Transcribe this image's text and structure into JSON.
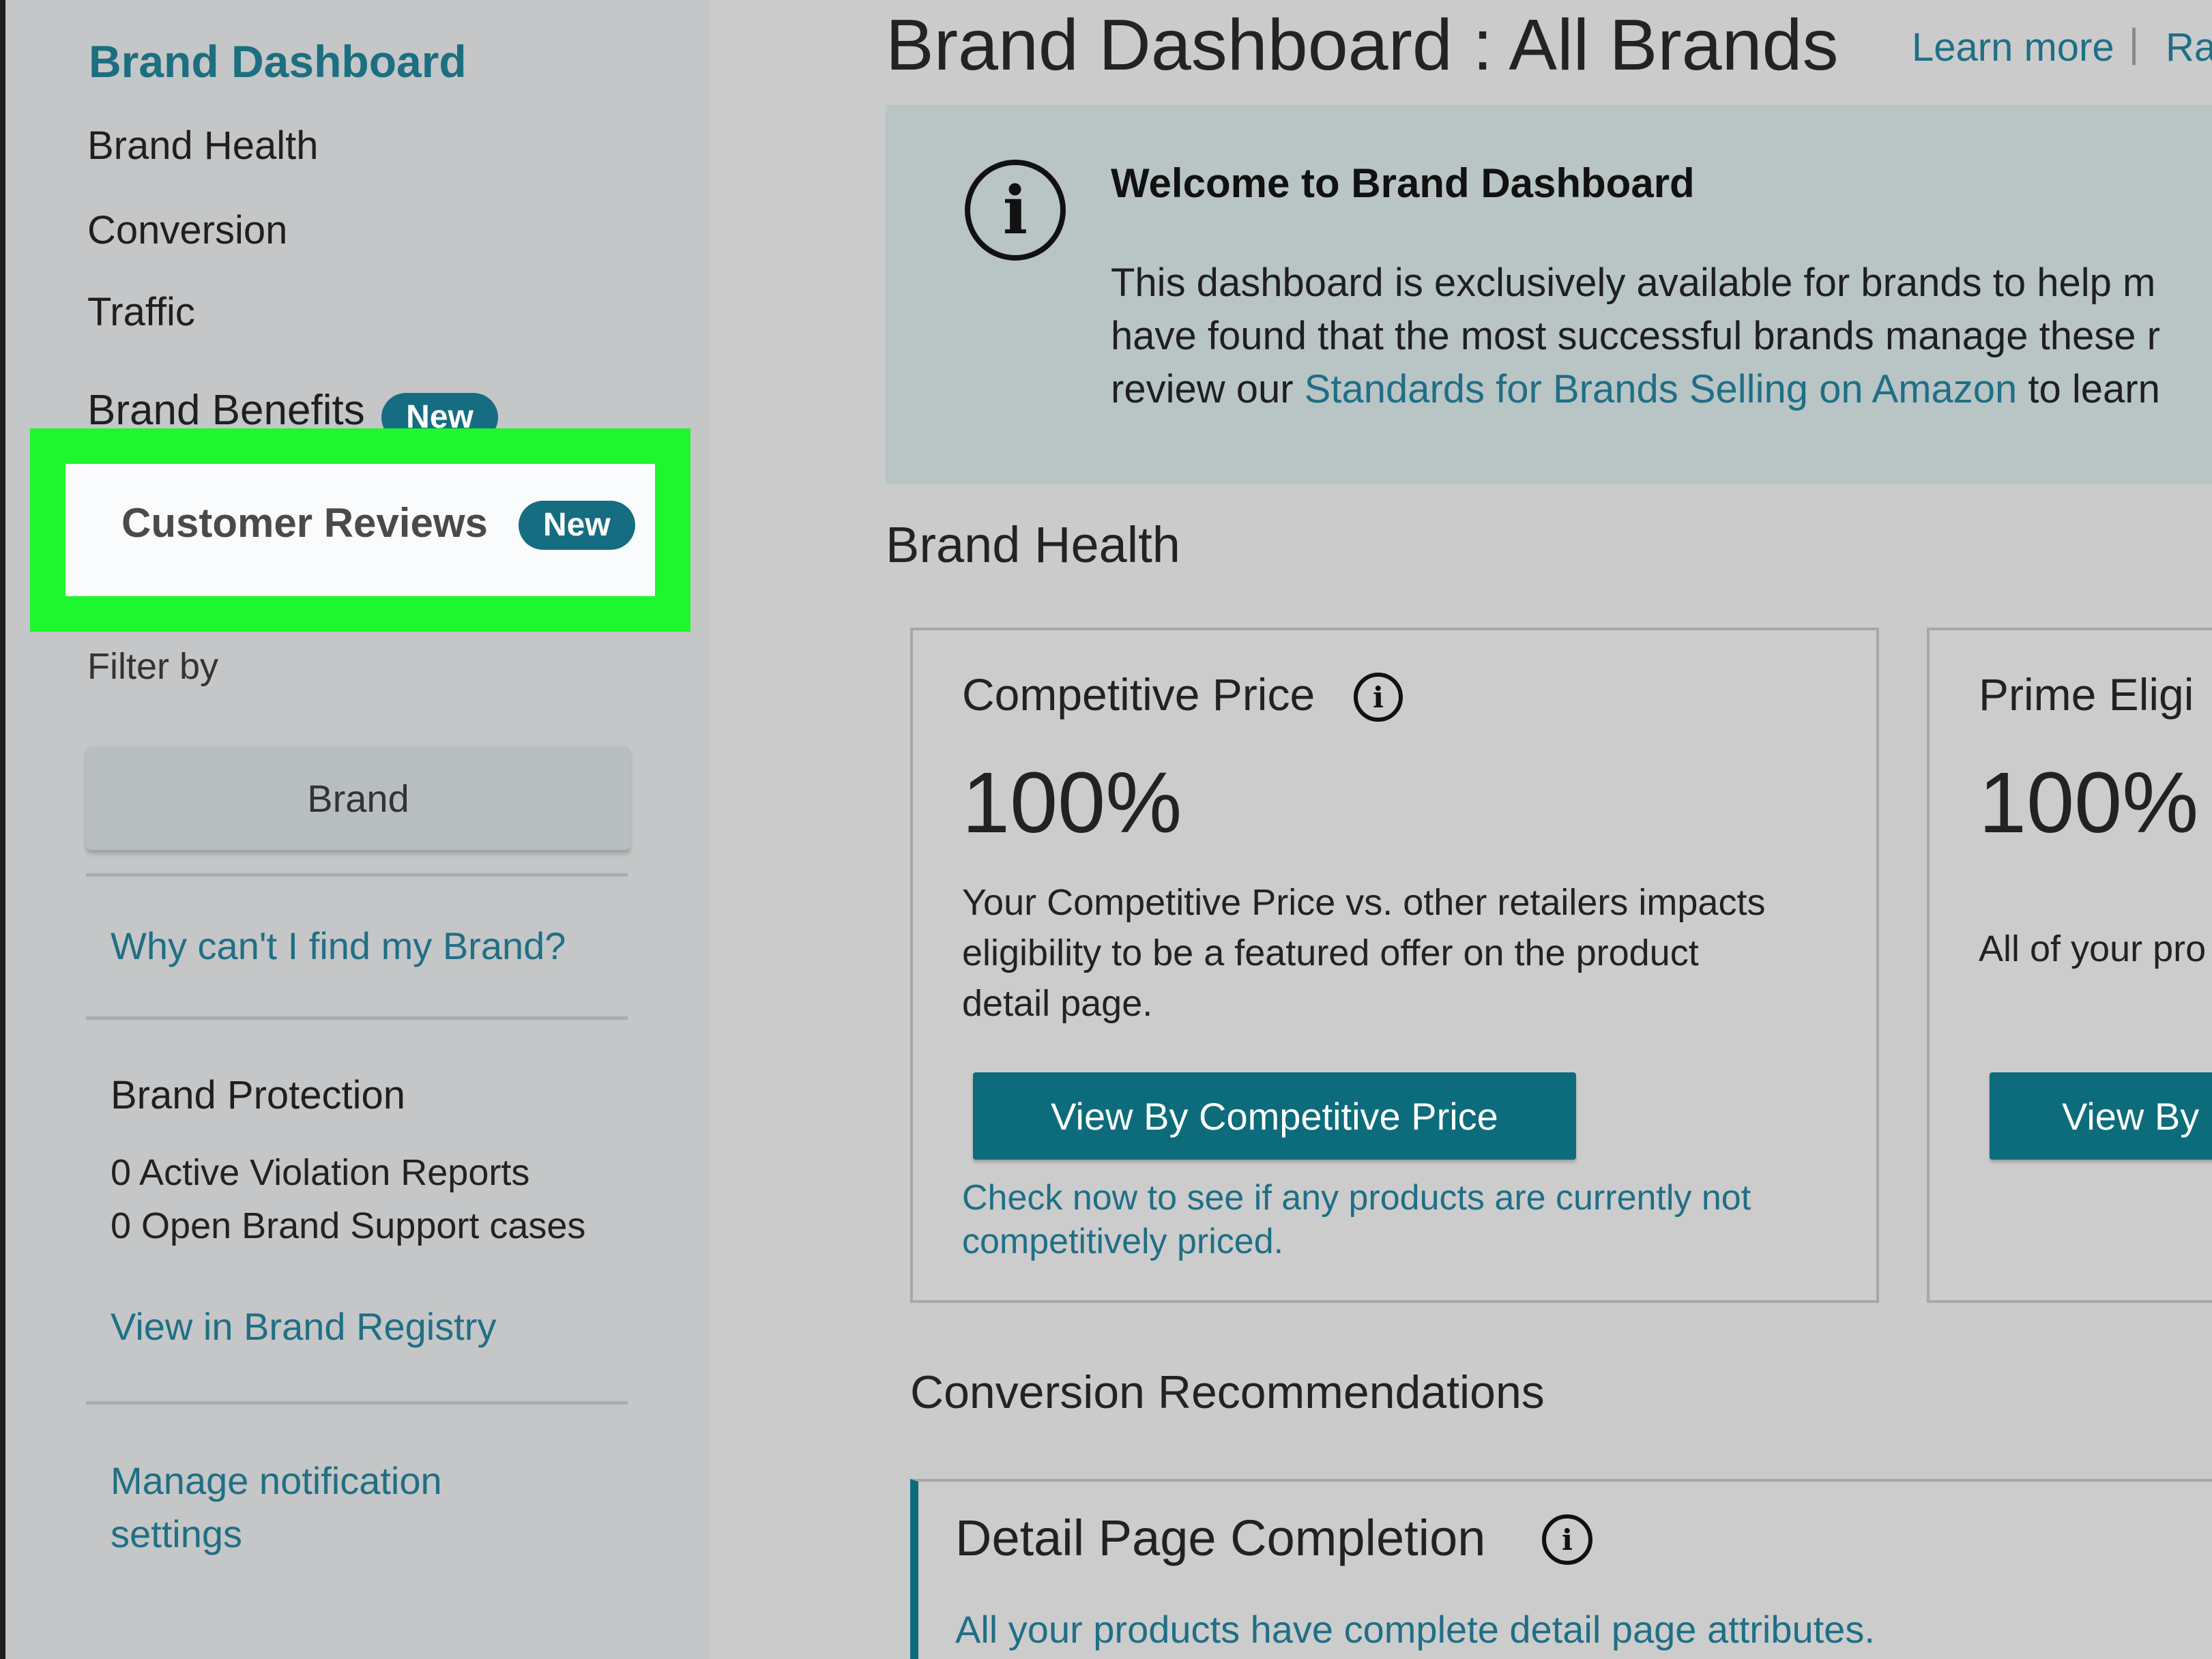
{
  "sidebar": {
    "title": "Brand Dashboard",
    "nav": [
      "Brand Health",
      "Conversion",
      "Traffic"
    ],
    "brand_benefits": {
      "label": "Brand Benefits",
      "badge": "New"
    },
    "customer_reviews": {
      "label": "Customer Reviews",
      "badge": "New"
    },
    "filter_label": "Filter by",
    "filter_button": "Brand",
    "find_brand_link": "Why can't I find my Brand?",
    "protection": {
      "heading": "Brand Protection",
      "violations": "0 Active Violation Reports",
      "support_cases": "0 Open Brand Support cases",
      "registry_link": "View in Brand Registry"
    },
    "notification_link_line1": "Manage notification",
    "notification_link_line2": "settings"
  },
  "header": {
    "title": "Brand Dashboard : All Brands",
    "learn_more": "Learn more",
    "separator": "|",
    "rate": "Rat"
  },
  "welcome": {
    "heading": "Welcome to Brand Dashboard",
    "line1": "This dashboard is exclusively available for brands to help m",
    "line2": "have found that the most successful brands manage these r",
    "line3_before": "review our ",
    "line3_link": "Standards for Brands Selling on Amazon",
    "line3_after": " to learn"
  },
  "brand_health": {
    "heading": "Brand Health",
    "competitive_price": {
      "title": "Competitive Price",
      "value": "100%",
      "desc_line1": "Your Competitive Price vs. other retailers impacts",
      "desc_line2": "eligibility to be a featured offer on the product",
      "desc_line3": "detail page.",
      "button": "View By Competitive Price",
      "note_line1": "Check now to see if any products are currently not",
      "note_line2": "competitively priced."
    },
    "prime_eligible": {
      "title": "Prime Eligi",
      "value": "100%",
      "desc": "All of your pro",
      "button": "View By"
    }
  },
  "conversion": {
    "heading": "Conversion Recommendations",
    "detail_page": {
      "title": "Detail Page Completion",
      "desc": "All your products have complete detail page attributes."
    }
  },
  "colors": {
    "accent_teal": "#0c6c7b",
    "highlight_green": "#1ef62e",
    "link_blue": "#1f6f86"
  }
}
